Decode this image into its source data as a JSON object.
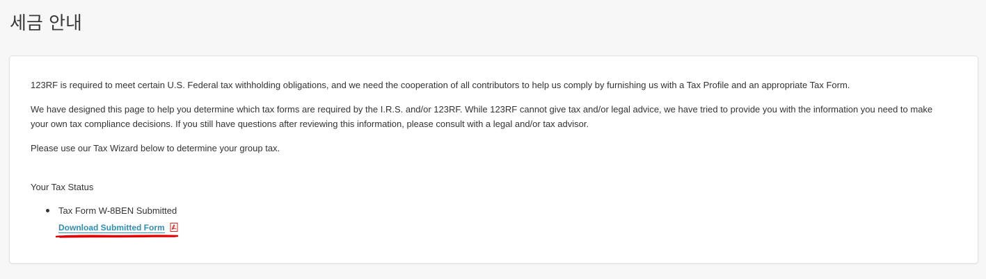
{
  "page": {
    "title": "세금 안내"
  },
  "intro": {
    "paragraph1": "123RF is required to meet certain U.S. Federal tax withholding obligations, and we need the cooperation of all contributors to help us comply by furnishing us with a Tax Profile and an appropriate Tax Form.",
    "paragraph2": "We have designed this page to help you determine which tax forms are required by the I.R.S. and/or 123RF. While 123RF cannot give tax and/or legal advice, we have tried to provide you with the information you need to make your own tax compliance decisions. If you still have questions after reviewing this information, please consult with a legal and/or tax advisor.",
    "paragraph3": "Please use our Tax Wizard below to determine your group tax."
  },
  "tax_status": {
    "label": "Your Tax Status",
    "items": [
      {
        "text": "Tax Form W-8BEN Submitted",
        "link_label": "Download Submitted Form",
        "icon": "pdf-icon"
      }
    ]
  },
  "colors": {
    "background": "#f7f7f7",
    "card": "#ffffff",
    "link": "#2d8fb5",
    "annotation": "#e00000",
    "pdf_icon": "#d9261c"
  }
}
